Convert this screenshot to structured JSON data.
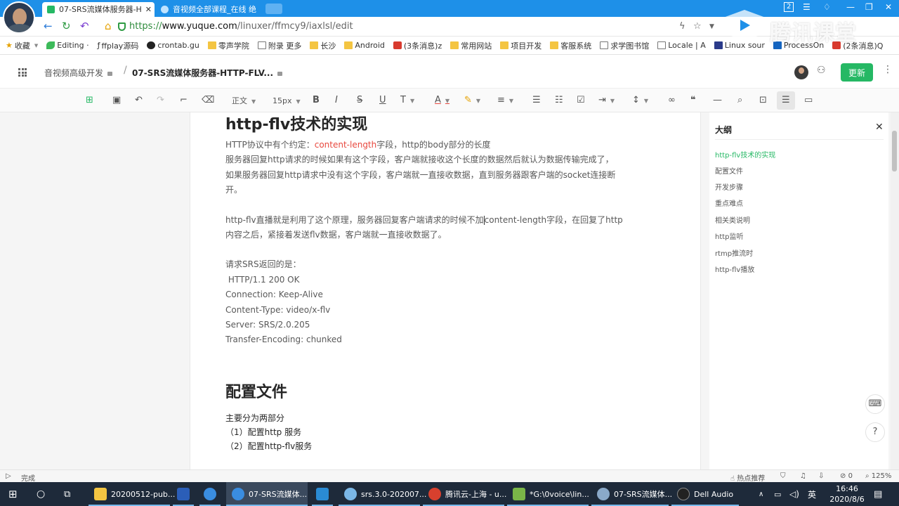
{
  "browser": {
    "tabs": [
      {
        "label": "07-SRS流媒体服务器-H",
        "active": true
      },
      {
        "label": "音视频全部课程_在线 绝",
        "active": false
      }
    ],
    "tab_badge": "2",
    "url_proto": "https://",
    "url_host": "www.yuque.com",
    "url_path": "/linuxer/ffmcy9/iaxlsl/edit",
    "brand_watermark": "腾讯课堂"
  },
  "bookmarks": [
    {
      "label": "收藏",
      "icon": "star-icon"
    },
    {
      "label": "Editing ·",
      "icon": "leaf-icon"
    },
    {
      "label": "ffplay源码",
      "icon": "f-icon"
    },
    {
      "label": "crontab.gu",
      "icon": "c-icon"
    },
    {
      "label": "零声学院",
      "icon": "folder-icon"
    },
    {
      "label": "附录 更多",
      "icon": "doc-icon"
    },
    {
      "label": "长沙",
      "icon": "folder-icon"
    },
    {
      "label": "Android",
      "icon": "folder-icon"
    },
    {
      "label": "(3条消息)z",
      "icon": "csdn-icon"
    },
    {
      "label": "常用网站",
      "icon": "folder-icon"
    },
    {
      "label": "项目开发",
      "icon": "folder-icon"
    },
    {
      "label": "客服系统",
      "icon": "folder-icon"
    },
    {
      "label": "求学图书馆",
      "icon": "doc-icon"
    },
    {
      "label": "Locale | A",
      "icon": "doc-icon"
    },
    {
      "label": "Linux sour",
      "icon": "linux-icon"
    },
    {
      "label": "ProcessOn",
      "icon": "on-icon"
    },
    {
      "label": "(2条消息)Q",
      "icon": "csdn-icon"
    }
  ],
  "app": {
    "breadcrumb_parent": "音视频高级开发",
    "breadcrumb_current": "07-SRS流媒体服务器-HTTP-FLV...",
    "update_label": "更新"
  },
  "toolbar": {
    "style_label": "正文",
    "size_label": "15px"
  },
  "doc": {
    "h1": "http-flv技术的实现",
    "p1_a": "HTTP协议中有个约定：",
    "p1_b": "content-length",
    "p1_c": "字段，http的body部分的长度",
    "p2": "服务器回复http请求的时候如果有这个字段，客户端就接收这个长度的数据然后就认为数据传输完成了，",
    "p3": "如果服务器回复http请求中没有这个字段，客户端就一直接收数据，直到服务器跟客户端的socket连接断",
    "p4": "开。",
    "p5_a": "http-flv直播就是利用了这个原理，服务器回复客户端请求的时候不加",
    "p5_b": "content-length字段，在回复了http",
    "p6": "内容之后，紧接着发送flv数据，客户端就一直接收数据了。",
    "p7": "请求SRS返回的是：",
    "resp": [
      " HTTP/1.1 200 OK",
      "Connection: Keep-Alive",
      "Content-Type: video/x-flv",
      "Server: SRS/2.0.205",
      "Transfer-Encoding: chunked"
    ],
    "h2": "配置文件",
    "p8": "主要分为两部分",
    "p9": "（1）配置http 服务",
    "p10": "（2）配置http-flv服务"
  },
  "outline": {
    "title": "大纲",
    "items": [
      "http-flv技术的实现",
      "配置文件",
      "开发步骤",
      "重点难点",
      "相关类说明",
      "http监听",
      "rtmp推流时",
      "http-flv播放"
    ]
  },
  "statusbar": {
    "left": "完成",
    "hot": "热点推荐",
    "zero": "0",
    "zoom": "125%"
  },
  "taskbar": {
    "items": [
      "20200512-pub...",
      "07-SRS流媒体...",
      "srs.3.0-202007...",
      "腾讯云-上海 - u...",
      "*G:\\0voice\\lin...",
      "07-SRS流媒体...",
      "Dell Audio"
    ],
    "time": "16:46",
    "date": "2020/8/6"
  },
  "colors": {
    "accent_green": "#25b864",
    "link_red": "#e8483e",
    "browser_blue": "#1e90e8"
  }
}
